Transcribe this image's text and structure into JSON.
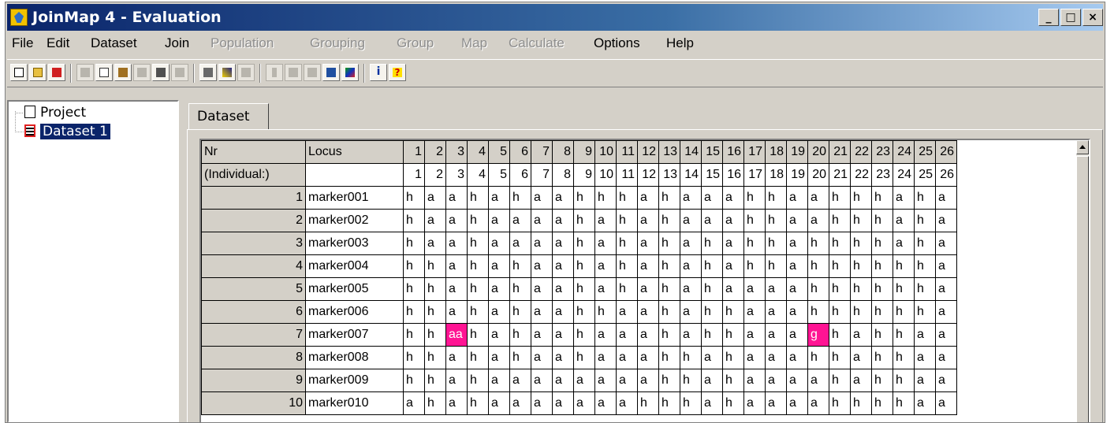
{
  "window": {
    "title": "JoinMap 4 - Evaluation"
  },
  "caption_buttons": {
    "minimize": "_",
    "maximize": "□",
    "close": "×"
  },
  "menus": [
    {
      "label": "File",
      "enabled": true
    },
    {
      "label": "Edit",
      "enabled": true
    },
    {
      "label": "Dataset",
      "enabled": true
    },
    {
      "label": "Join",
      "enabled": true
    },
    {
      "label": "Population",
      "enabled": false
    },
    {
      "label": "Grouping",
      "enabled": false
    },
    {
      "label": "Group",
      "enabled": false
    },
    {
      "label": "Map",
      "enabled": false
    },
    {
      "label": "Calculate",
      "enabled": false
    },
    {
      "label": "Options",
      "enabled": true
    },
    {
      "label": "Help",
      "enabled": true
    }
  ],
  "toolbar": {
    "buttons": [
      {
        "icon": "new-file-icon",
        "enabled": true
      },
      {
        "icon": "open-folder-icon",
        "enabled": true
      },
      {
        "icon": "import-icon",
        "enabled": true
      },
      {
        "icon": "cut-icon",
        "enabled": false
      },
      {
        "icon": "copy-icon",
        "enabled": true
      },
      {
        "icon": "paste-icon",
        "enabled": true
      },
      {
        "icon": "calculator-icon",
        "enabled": false
      },
      {
        "icon": "tools-icon",
        "enabled": true
      },
      {
        "icon": "print-icon",
        "enabled": false
      },
      {
        "icon": "hammer-icon",
        "enabled": true
      },
      {
        "icon": "heatmap-icon",
        "enabled": true
      },
      {
        "icon": "chart-icon",
        "enabled": false
      },
      {
        "icon": "bar-icon",
        "enabled": false
      },
      {
        "icon": "grid-icon",
        "enabled": false
      },
      {
        "icon": "plot-icon",
        "enabled": false
      },
      {
        "icon": "save-icon",
        "enabled": true
      },
      {
        "icon": "colormap-icon",
        "enabled": true
      },
      {
        "icon": "info-icon",
        "enabled": true
      },
      {
        "icon": "help-icon",
        "enabled": true
      }
    ]
  },
  "tree": {
    "items": [
      {
        "label": "Project",
        "icon": "document-icon",
        "selected": false
      },
      {
        "label": "Dataset 1",
        "icon": "grid-icon",
        "selected": true
      }
    ]
  },
  "tab": {
    "label": "Dataset"
  },
  "grid": {
    "header_nr": "Nr",
    "header_locus": "Locus",
    "header_individual": "(Individual:)",
    "columns": [
      "1",
      "2",
      "3",
      "4",
      "5",
      "6",
      "7",
      "8",
      "9",
      "10",
      "11",
      "12",
      "13",
      "14",
      "15",
      "16",
      "17",
      "18",
      "19",
      "20",
      "21",
      "22",
      "23",
      "24",
      "25",
      "26"
    ],
    "rows": [
      {
        "nr": "1",
        "locus": "marker001",
        "calls": [
          "h",
          "a",
          "a",
          "h",
          "a",
          "h",
          "a",
          "a",
          "h",
          "h",
          "h",
          "a",
          "h",
          "a",
          "a",
          "a",
          "h",
          "h",
          "a",
          "a",
          "h",
          "h",
          "h",
          "a",
          "h",
          "a"
        ]
      },
      {
        "nr": "2",
        "locus": "marker002",
        "calls": [
          "h",
          "a",
          "a",
          "h",
          "a",
          "a",
          "a",
          "a",
          "h",
          "a",
          "h",
          "a",
          "h",
          "a",
          "a",
          "a",
          "h",
          "h",
          "a",
          "a",
          "h",
          "h",
          "h",
          "a",
          "h",
          "a"
        ]
      },
      {
        "nr": "3",
        "locus": "marker003",
        "calls": [
          "h",
          "a",
          "a",
          "h",
          "a",
          "a",
          "a",
          "a",
          "h",
          "a",
          "h",
          "a",
          "h",
          "a",
          "h",
          "a",
          "h",
          "h",
          "a",
          "h",
          "h",
          "h",
          "h",
          "a",
          "h",
          "a"
        ]
      },
      {
        "nr": "4",
        "locus": "marker004",
        "calls": [
          "h",
          "h",
          "a",
          "h",
          "a",
          "h",
          "a",
          "a",
          "h",
          "a",
          "h",
          "a",
          "h",
          "a",
          "h",
          "a",
          "h",
          "h",
          "a",
          "h",
          "h",
          "h",
          "h",
          "h",
          "h",
          "a"
        ]
      },
      {
        "nr": "5",
        "locus": "marker005",
        "calls": [
          "h",
          "h",
          "a",
          "h",
          "a",
          "h",
          "a",
          "a",
          "h",
          "a",
          "h",
          "a",
          "h",
          "a",
          "h",
          "a",
          "a",
          "a",
          "a",
          "h",
          "h",
          "h",
          "h",
          "h",
          "h",
          "a"
        ]
      },
      {
        "nr": "6",
        "locus": "marker006",
        "calls": [
          "h",
          "h",
          "a",
          "h",
          "a",
          "h",
          "a",
          "a",
          "h",
          "h",
          "a",
          "a",
          "h",
          "a",
          "h",
          "h",
          "a",
          "a",
          "a",
          "h",
          "h",
          "h",
          "h",
          "h",
          "h",
          "a"
        ]
      },
      {
        "nr": "7",
        "locus": "marker007",
        "calls": [
          "h",
          "h",
          "aa",
          "h",
          "a",
          "h",
          "a",
          "a",
          "h",
          "a",
          "a",
          "a",
          "h",
          "a",
          "h",
          "h",
          "a",
          "a",
          "a",
          "g",
          "h",
          "a",
          "h",
          "h",
          "a",
          "a"
        ]
      },
      {
        "nr": "8",
        "locus": "marker008",
        "calls": [
          "h",
          "h",
          "a",
          "h",
          "a",
          "h",
          "a",
          "a",
          "h",
          "a",
          "a",
          "a",
          "h",
          "h",
          "a",
          "h",
          "a",
          "a",
          "a",
          "h",
          "h",
          "a",
          "h",
          "h",
          "a",
          "a"
        ]
      },
      {
        "nr": "9",
        "locus": "marker009",
        "calls": [
          "h",
          "h",
          "a",
          "h",
          "a",
          "a",
          "a",
          "a",
          "a",
          "a",
          "a",
          "a",
          "h",
          "h",
          "a",
          "h",
          "a",
          "a",
          "a",
          "a",
          "h",
          "a",
          "h",
          "h",
          "a",
          "a"
        ]
      },
      {
        "nr": "10",
        "locus": "marker010",
        "calls": [
          "a",
          "h",
          "a",
          "h",
          "a",
          "a",
          "a",
          "a",
          "a",
          "a",
          "a",
          "h",
          "h",
          "h",
          "a",
          "h",
          "a",
          "a",
          "a",
          "a",
          "h",
          "h",
          "h",
          "h",
          "a",
          "a"
        ]
      }
    ],
    "highlights": [
      {
        "row": 7,
        "col": 3,
        "color": "#ff1493"
      },
      {
        "row": 7,
        "col": 20,
        "color": "#ff1493"
      }
    ]
  }
}
